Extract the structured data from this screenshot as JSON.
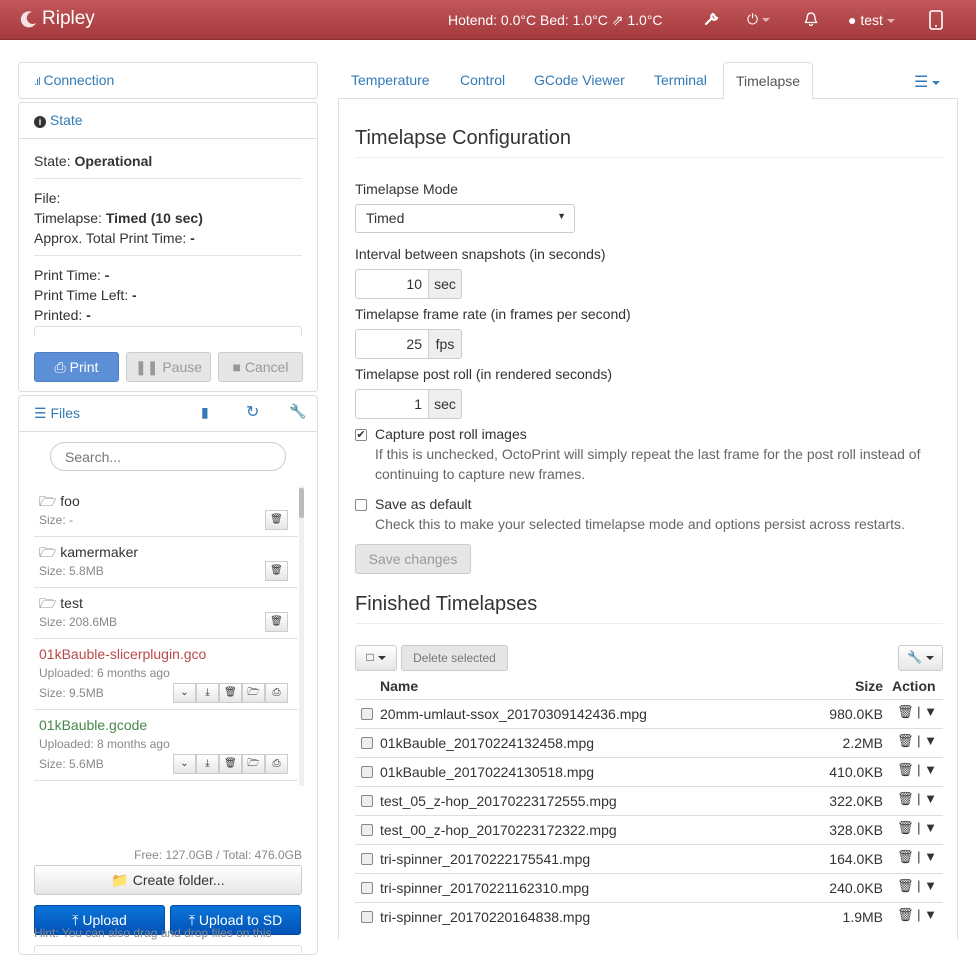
{
  "navbar": {
    "brand": "Ripley",
    "temps": "Hotend: 0.0°C  Bed: 1.0°C ⇗ 1.0°C",
    "user": "test"
  },
  "sidebar": {
    "connection_title": "Connection",
    "state_title": "State",
    "state": {
      "state_label": "State:",
      "state_value": "Operational",
      "file_label": "File:",
      "timelapse_label": "Timelapse:",
      "timelapse_value": "Timed (10 sec)",
      "approx_label": "Approx. Total Print Time:",
      "approx_value": "-",
      "print_time_label": "Print Time:",
      "print_time_value": "-",
      "print_time_left_label": "Print Time Left:",
      "print_time_left_value": "-",
      "printed_label": "Printed:",
      "printed_value": "-"
    },
    "buttons": {
      "print": "Print",
      "pause": "Pause",
      "cancel": "Cancel"
    },
    "files_title": "Files",
    "search_placeholder": "Search...",
    "files": [
      {
        "name": "foo",
        "type": "folder",
        "meta1": "Size: -"
      },
      {
        "name": "kamermaker",
        "type": "folder",
        "meta1": "Size: 5.8MB"
      },
      {
        "name": "test",
        "type": "folder",
        "meta1": "Size: 208.6MB"
      },
      {
        "name": "01kBauble-slicerplugin.gco",
        "type": "file",
        "color": "#b94a48",
        "meta1": "Uploaded: 6 months ago",
        "meta2": "Size: 9.5MB"
      },
      {
        "name": "01kBauble.gcode",
        "type": "file",
        "color": "#468847",
        "meta1": "Uploaded: 8 months ago",
        "meta2": "Size: 5.6MB"
      }
    ],
    "free_total": "Free: 127.0GB / Total: 476.0GB",
    "create_folder": "Create folder...",
    "upload": "Upload",
    "upload_sd": "Upload to SD",
    "hint": "Hint: You can also drag and drop files on this"
  },
  "tabs": [
    "Temperature",
    "Control",
    "GCode Viewer",
    "Terminal",
    "Timelapse"
  ],
  "timelapse": {
    "config_title": "Timelapse Configuration",
    "mode_label": "Timelapse Mode",
    "mode_value": "Timed",
    "interval_label": "Interval between snapshots (in seconds)",
    "interval_value": "10",
    "interval_unit": "sec",
    "framerate_label": "Timelapse frame rate (in frames per second)",
    "framerate_value": "25",
    "framerate_unit": "fps",
    "postroll_label": "Timelapse post roll (in rendered seconds)",
    "postroll_value": "1",
    "postroll_unit": "sec",
    "capture_label": "Capture post roll images",
    "capture_help": "If this is unchecked, OctoPrint will simply repeat the last frame for the post roll instead of continuing to capture new frames.",
    "capture_help_line1": "If this is unchecked, OctoPrint will simply repeat the last frame for the post roll instead of",
    "capture_help_line2": "continuing to capture new frames.",
    "default_label": "Save as default",
    "default_help": "Check this to make your selected timelapse mode and options persist across restarts.",
    "save_button": "Save changes",
    "finished_title": "Finished Timelapses",
    "delete_selected": "Delete selected",
    "col_name": "Name",
    "col_size": "Size",
    "col_action": "Action",
    "rows": [
      {
        "name": "20mm-umlaut-ssox_20170309142436.mpg",
        "size": "980.0KB"
      },
      {
        "name": "01kBauble_20170224132458.mpg",
        "size": "2.2MB"
      },
      {
        "name": "01kBauble_20170224130518.mpg",
        "size": "410.0KB"
      },
      {
        "name": "test_05_z-hop_20170223172555.mpg",
        "size": "322.0KB"
      },
      {
        "name": "test_00_z-hop_20170223172322.mpg",
        "size": "328.0KB"
      },
      {
        "name": "tri-spinner_20170222175541.mpg",
        "size": "164.0KB"
      },
      {
        "name": "tri-spinner_20170221162310.mpg",
        "size": "240.0KB"
      },
      {
        "name": "tri-spinner_20170220164838.mpg",
        "size": "1.9MB"
      }
    ]
  }
}
